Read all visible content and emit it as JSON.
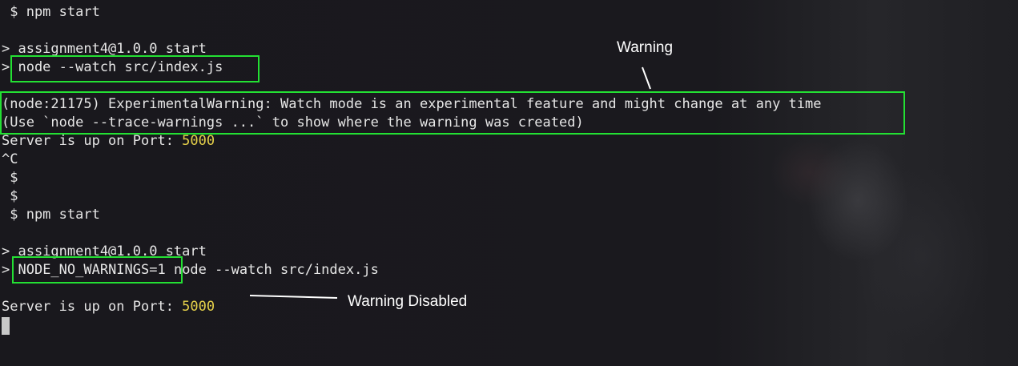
{
  "terminal": {
    "lines": [
      " $ npm start",
      "",
      "> assignment4@1.0.0 start",
      "> node --watch src/index.js",
      "",
      "(node:21175) ExperimentalWarning: Watch mode is an experimental feature and might change at any time",
      "(Use `node --trace-warnings ...` to show where the warning was created)",
      "Server is up on Port: ",
      "^C",
      " $",
      " $",
      " $ npm start",
      "",
      "> assignment4@1.0.0 start",
      "> ",
      "",
      "Server is up on Port: "
    ],
    "port_1": "5000",
    "port_2": "5000",
    "flag_text": "NODE_NO_WARNINGS=1",
    "cmd_rest": " node --watch src/index.js"
  },
  "annotations": {
    "warning_label": "Warning",
    "disabled_label": "Warning Disabled"
  },
  "colors": {
    "highlight_box": "#23e033",
    "port_value": "#e5d04a",
    "background": "#1a191e"
  }
}
